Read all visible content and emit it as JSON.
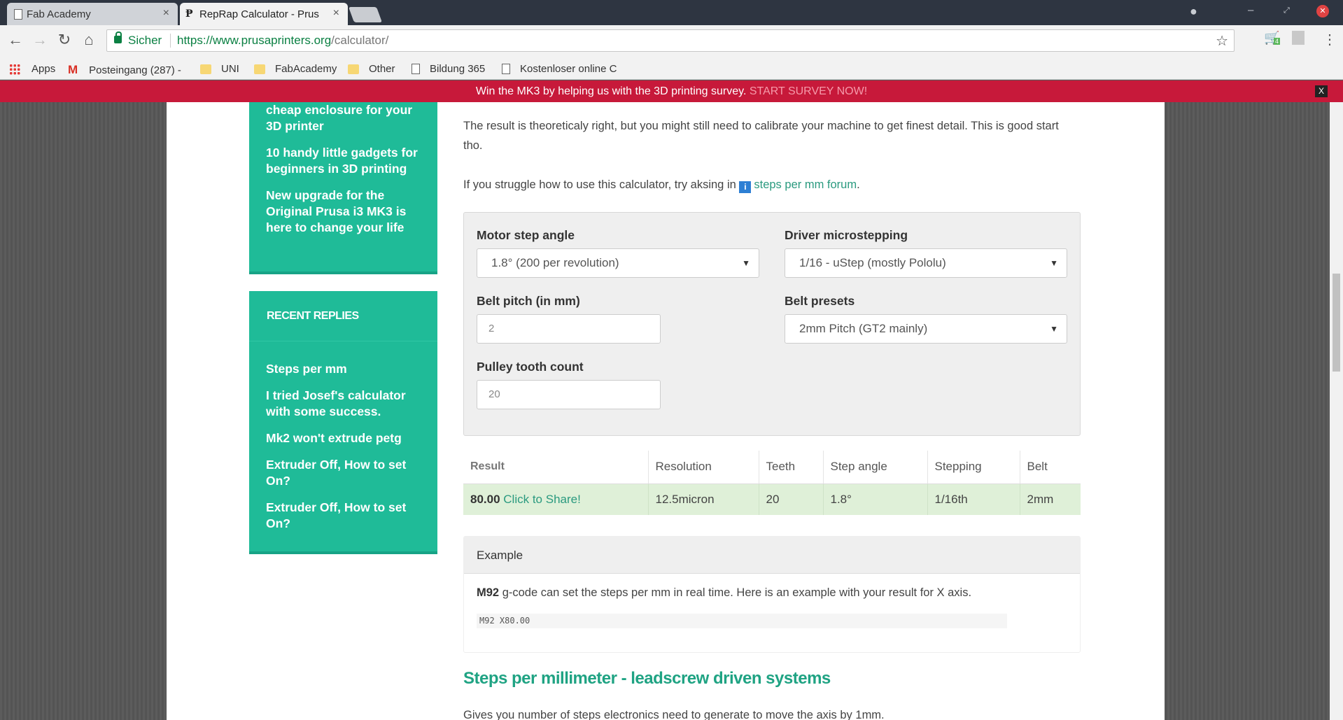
{
  "tabs": [
    {
      "title": "Fab Academy",
      "close": "×"
    },
    {
      "title": "RepRap Calculator - Prus",
      "close": "×"
    }
  ],
  "window_controls": {
    "minimize": "–",
    "restore": "⤢",
    "close": "✕"
  },
  "toolbar": {
    "back_icon": "←",
    "forward_icon": "→",
    "reload_icon": "↻",
    "home_icon": "⌂",
    "secure_label": "Sicher",
    "url_host": "https://www.prusaprinters.org",
    "url_path": "/calculator/",
    "bookmark_star": "☆",
    "ext_badge": "4",
    "menu_icon": "⋮"
  },
  "bookmarks": [
    {
      "label": "Apps",
      "icon": "apps-grid-icon"
    },
    {
      "label": "Posteingang (287) - ",
      "icon": "gmail-icon"
    },
    {
      "label": "UNI",
      "icon": "folder-icon"
    },
    {
      "label": "FabAcademy",
      "icon": "folder-icon"
    },
    {
      "label": "Other",
      "icon": "folder-icon"
    },
    {
      "label": "Bildung 365",
      "icon": "page-icon"
    },
    {
      "label": "Kostenloser online C",
      "icon": "page-icon"
    }
  ],
  "survey": {
    "text": "Win the MK3 by helping us with the 3D printing survey. ",
    "cta": "START SURVEY NOW!",
    "close": "X"
  },
  "sidebar": {
    "popular_links": [
      "cheap enclosure for your 3D printer",
      "10 handy little gadgets for beginners in 3D printing",
      "New upgrade for the Original Prusa i3 MK3 is here to change your life"
    ],
    "recent_heading": "RECENT REPLIES",
    "recent_links": [
      "Steps per mm",
      "I tried Josef's calculator with some success.",
      "Mk2 won't extrude petg",
      "Extruder Off, How to set On?",
      "Extruder Off, How to set On?"
    ]
  },
  "main": {
    "intro_text": "The result is theoreticaly right, but you might still need to calibrate your machine to get finest detail. This is good start tho.",
    "help_prefix": "If you struggle how to use this calculator, try aksing in ",
    "help_icon": "i",
    "help_link": "steps per mm forum",
    "help_suffix": "."
  },
  "calculator": {
    "motor_step_label": "Motor step angle",
    "motor_step_value": "1.8° (200 per revolution)",
    "driver_label": "Driver microstepping",
    "driver_value": "1/16 - uStep (mostly Pololu)",
    "belt_pitch_label": "Belt pitch (in mm)",
    "belt_pitch_value": "2",
    "belt_presets_label": "Belt presets",
    "belt_presets_value": "2mm Pitch (GT2 mainly)",
    "pulley_label": "Pulley tooth count",
    "pulley_value": "20",
    "select_arrow": "▼"
  },
  "results": {
    "headers": [
      "Result",
      "Resolution",
      "Teeth",
      "Step angle",
      "Stepping",
      "Belt"
    ],
    "result_value": "80.00",
    "share_link": "Click to Share!",
    "resolution": "12.5micron",
    "teeth": "20",
    "step_angle": "1.8°",
    "stepping": "1/16th",
    "belt": "2mm"
  },
  "example": {
    "heading": "Example",
    "gcode": "M92",
    "text": " g-code can set the steps per mm in real time. Here is an example with your result for X axis.",
    "code": "M92 X80.00"
  },
  "leadscrew": {
    "title": "Steps per millimeter - leadscrew driven systems",
    "text": "Gives you number of steps electronics need to generate to move the axis by 1mm."
  },
  "colors": {
    "accent_teal": "#1fbb98",
    "banner_red": "#c7193a",
    "result_row_green": "#dff0d8",
    "link_teal": "#2a9a7f"
  }
}
